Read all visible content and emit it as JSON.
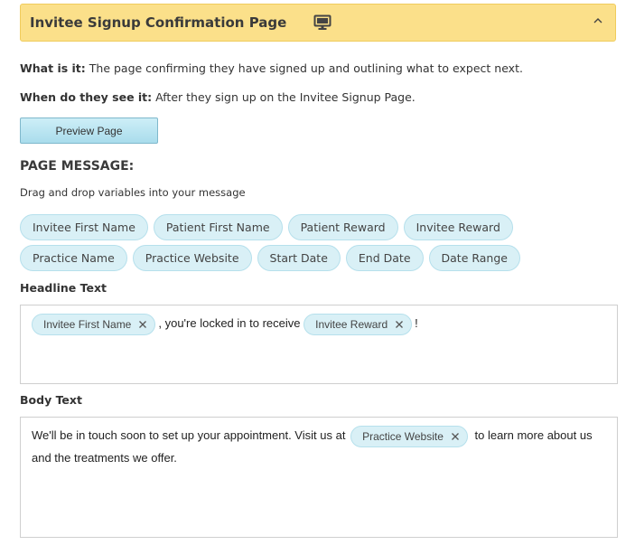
{
  "header": {
    "title": "Invitee Signup Confirmation Page",
    "monitor_icon": "monitor-icon",
    "collapse_icon": "chevron-up-icon",
    "bg_color": "#fbe08a"
  },
  "info": {
    "what_label": "What is it:",
    "what_text": " The page confirming they have signed up and outlining what to expect next.",
    "when_label": "When do they see it:",
    "when_text": " After they sign up on the Invitee Signup Page."
  },
  "preview_button": {
    "label": "Preview Page"
  },
  "message": {
    "title": "PAGE MESSAGE:",
    "hint": "Drag and drop variables into your message",
    "variables": [
      "Invitee First Name",
      "Patient First Name",
      "Patient Reward",
      "Invitee Reward",
      "Practice Name",
      "Practice Website",
      "Start Date",
      "End Date",
      "Date Range"
    ]
  },
  "headline": {
    "label": "Headline Text",
    "tag1": "Invitee First Name",
    "text1": ", you're locked in to receive",
    "tag2": "Invitee Reward",
    "text2": "!"
  },
  "body": {
    "label": "Body Text",
    "text1": "We'll be in touch soon to set up your appointment. Visit us at",
    "tag1": "Practice Website",
    "text2": "to learn more about us and the treatments we offer."
  },
  "colors": {
    "chip_bg": "#d9f0f6",
    "chip_border": "#b6e0ec",
    "button_bg": "#a9dcec"
  }
}
